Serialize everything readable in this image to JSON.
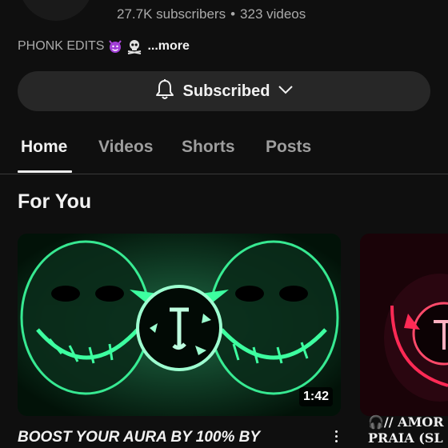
{
  "channel": {
    "subscriber_count": "27.7K subscribers",
    "separator": "•",
    "video_count": "323 videos",
    "description": "PHONK EDITS",
    "more_label": "...more"
  },
  "subscribe_button": {
    "label": "Subscribed",
    "icons": [
      "bell-icon",
      "chevron-down-icon"
    ]
  },
  "tabs": [
    {
      "label": "Home",
      "active": true
    },
    {
      "label": "Videos",
      "active": false
    },
    {
      "label": "Shorts",
      "active": false
    },
    {
      "label": "Posts",
      "active": false
    }
  ],
  "section": {
    "title": "For You"
  },
  "videos": [
    {
      "title": "BOOST YOUR AURA BY 100% BY",
      "duration": "1:42"
    },
    {
      "title": "🎧// AMOR\nPRAIA (SL"
    }
  ],
  "colors": {
    "background": "#0f0f0f",
    "button_bg": "#272727",
    "text_primary": "#f1f1f1",
    "text_secondary": "#aaaaaa",
    "thumb1_glow": "#3dffa0",
    "thumb2_glow": "#ff2a55"
  }
}
